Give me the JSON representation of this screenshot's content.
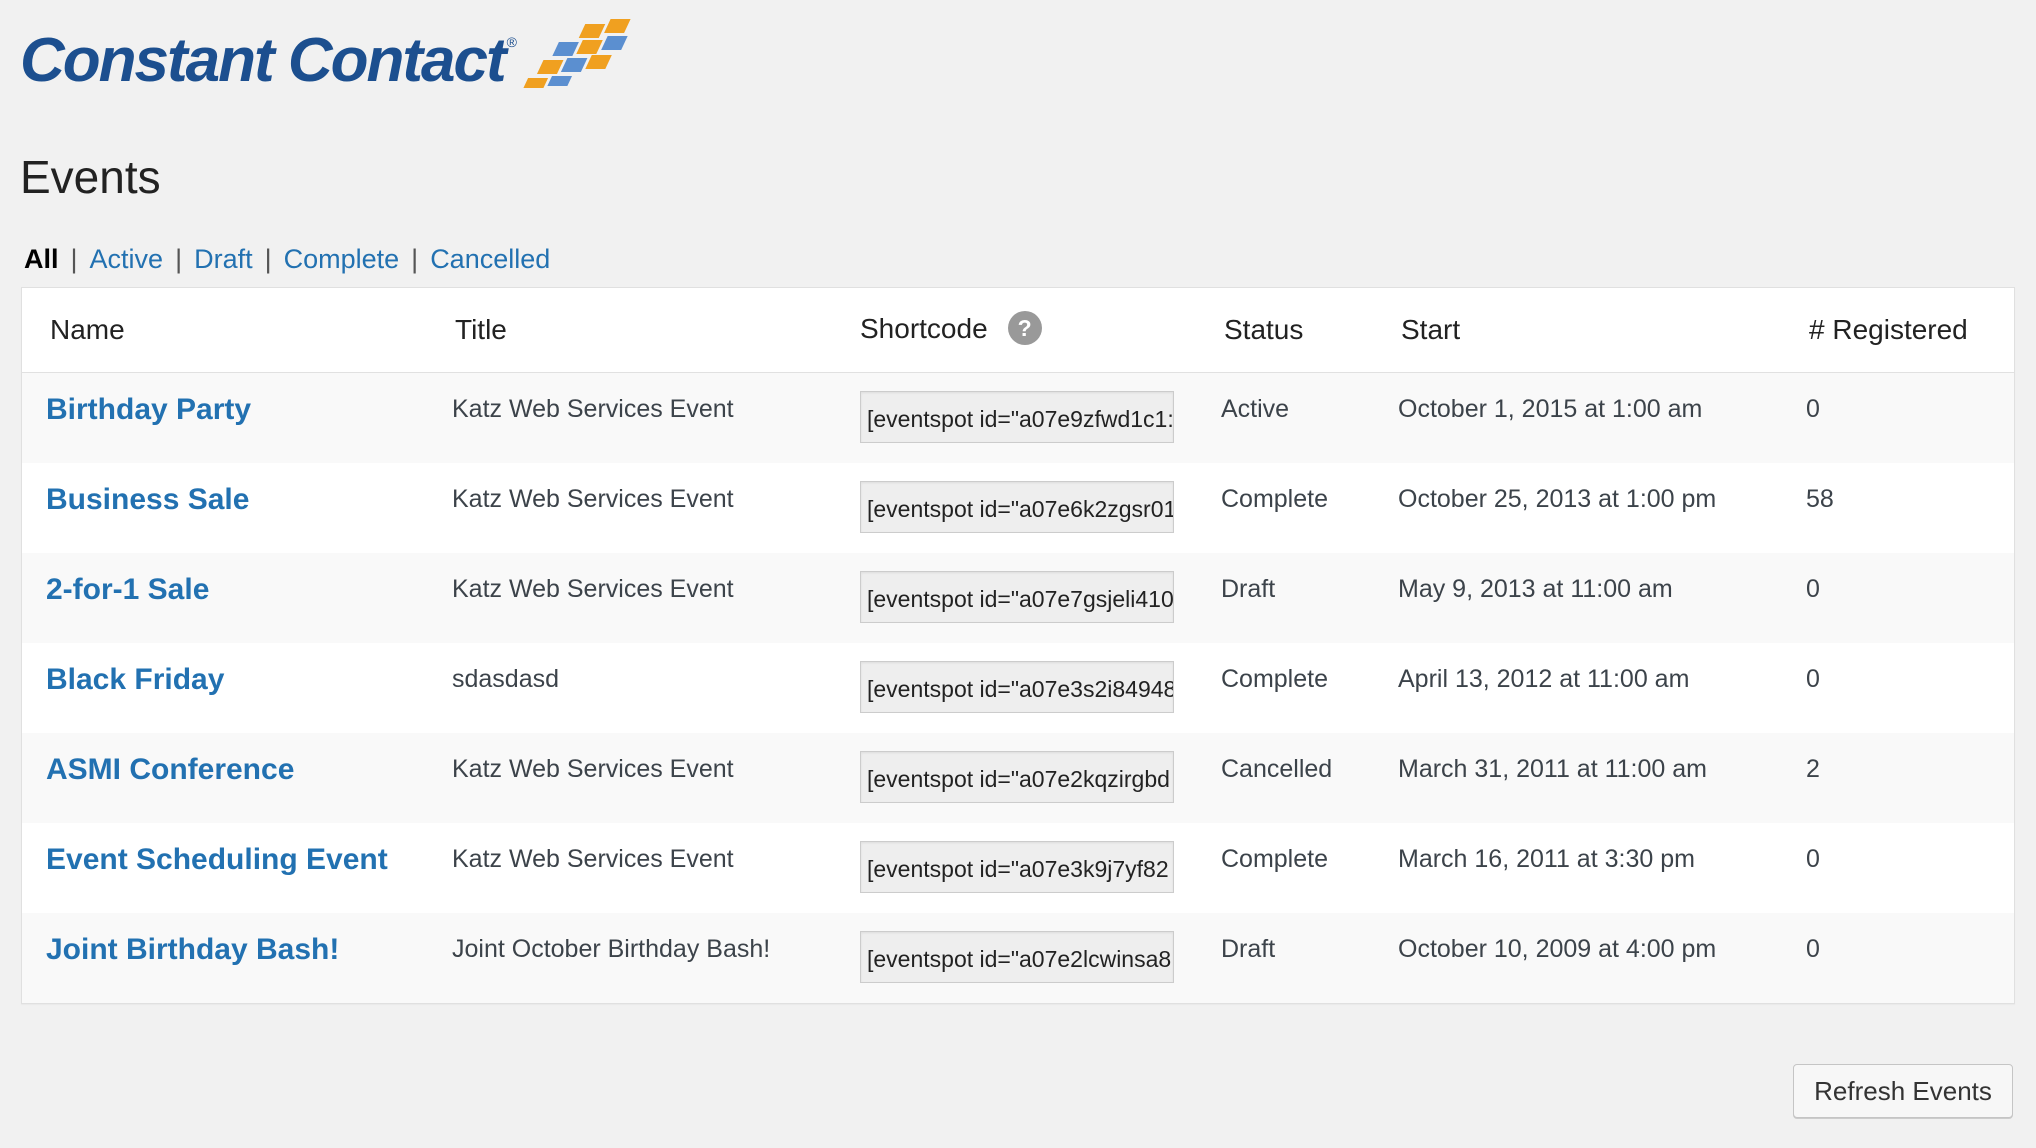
{
  "logo": {
    "text": "Constant Contact",
    "registered": "®"
  },
  "page": {
    "title": "Events"
  },
  "filters": [
    {
      "label": "All",
      "current": true
    },
    {
      "label": "Active",
      "current": false
    },
    {
      "label": "Draft",
      "current": false
    },
    {
      "label": "Complete",
      "current": false
    },
    {
      "label": "Cancelled",
      "current": false
    }
  ],
  "table": {
    "columns": {
      "name": "Name",
      "title": "Title",
      "shortcode": "Shortcode",
      "status": "Status",
      "start": "Start",
      "registered": "# Registered"
    },
    "help_icon": "?",
    "rows": [
      {
        "name": "Birthday Party",
        "title": "Katz Web Services Event",
        "shortcode": "[eventspot id=\"a07e9zfwd1c1:",
        "status": "Active",
        "start": "October 1, 2015 at 1:00 am",
        "registered": "0"
      },
      {
        "name": "Business Sale",
        "title": "Katz Web Services Event",
        "shortcode": "[eventspot id=\"a07e6k2zgsr01",
        "status": "Complete",
        "start": "October 25, 2013 at 1:00 pm",
        "registered": "58"
      },
      {
        "name": "2-for-1 Sale",
        "title": "Katz Web Services Event",
        "shortcode": "[eventspot id=\"a07e7gsjeli410",
        "status": "Draft",
        "start": "May 9, 2013 at 11:00 am",
        "registered": "0"
      },
      {
        "name": "Black Friday",
        "title": "sdasdasd",
        "shortcode": "[eventspot id=\"a07e3s2i84948",
        "status": "Complete",
        "start": "April 13, 2012 at 11:00 am",
        "registered": "0"
      },
      {
        "name": "ASMI Conference",
        "title": "Katz Web Services Event",
        "shortcode": "[eventspot id=\"a07e2kqzirgbd",
        "status": "Cancelled",
        "start": "March 31, 2011 at 11:00 am",
        "registered": "2"
      },
      {
        "name": "Event Scheduling Event",
        "title": "Katz Web Services Event",
        "shortcode": "[eventspot id=\"a07e3k9j7yf82",
        "status": "Complete",
        "start": "March 16, 2011 at 3:30 pm",
        "registered": "0"
      },
      {
        "name": "Joint Birthday Bash!",
        "title": "Joint October Birthday Bash!",
        "shortcode": "[eventspot id=\"a07e2lcwinsa8",
        "status": "Draft",
        "start": "October 10, 2009 at 4:00 pm",
        "registered": "0"
      }
    ]
  },
  "actions": {
    "refresh_label": "Refresh Events"
  },
  "colors": {
    "brand_blue": "#1c4f8f",
    "link": "#2271b1",
    "logo_orange": "#f0a020",
    "logo_blue": "#5b8fd0"
  }
}
